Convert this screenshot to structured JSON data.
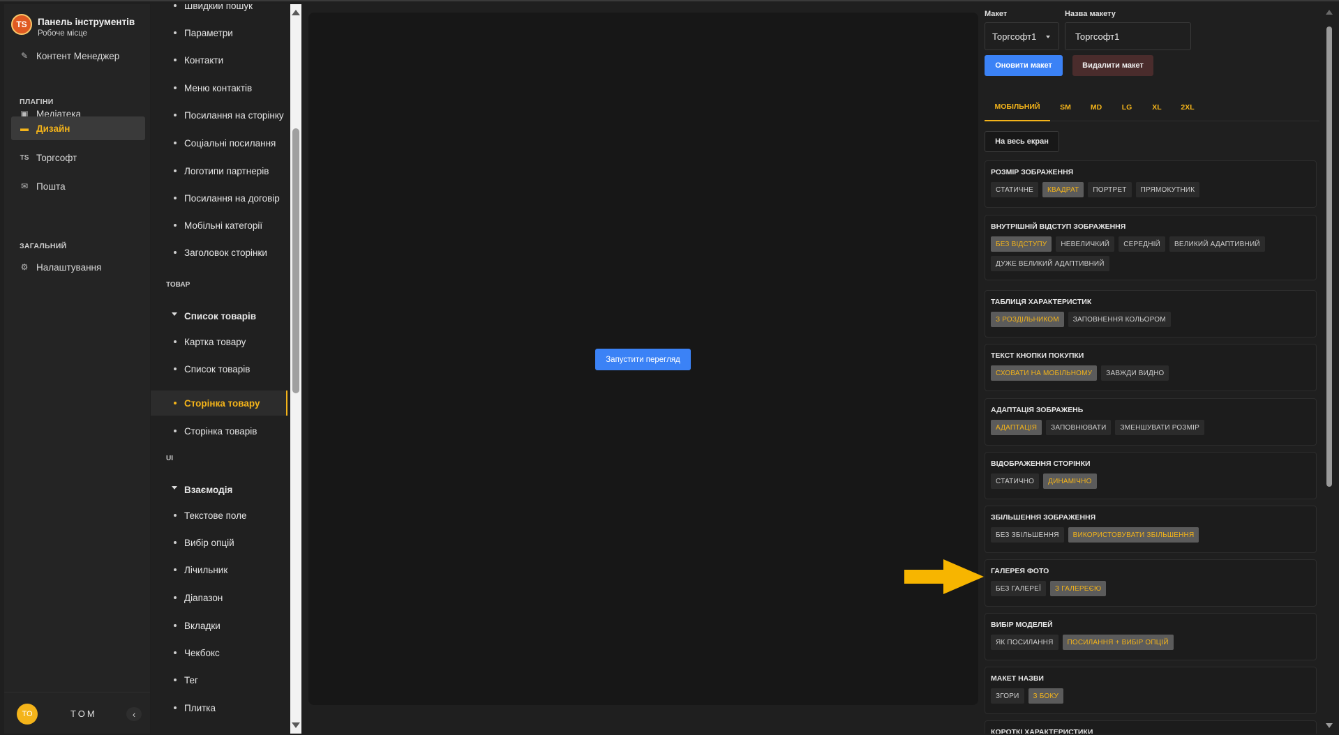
{
  "brand": {
    "logo": "TS",
    "title": "Панель інструментів",
    "subtitle": "Робоче місце"
  },
  "sidebar": {
    "items": [
      {
        "label": "Контент Менеджер",
        "icon": "edit-icon"
      },
      {
        "label": "Медіатека",
        "icon": "image-icon"
      },
      {
        "label": "Дизайн",
        "icon": "design-icon",
        "active": true
      },
      {
        "label": "Торгсофт",
        "icon": "ts-icon"
      },
      {
        "label": "Пошта",
        "icon": "mail-icon"
      },
      {
        "label": "Налаштування",
        "icon": "gear-icon"
      }
    ],
    "sections": {
      "plugins": "ПЛАГІНИ",
      "general": "ЗАГАЛЬНИЙ"
    },
    "user": {
      "initials": "TO",
      "name": "TOM"
    }
  },
  "tree": {
    "partial_top": "Швидкий пошук",
    "items": [
      "Параметри",
      "Контакти",
      "Меню контактів",
      "Посилання на сторінку",
      "Соціальні посилання",
      "Логотипи партнерів",
      "Посилання на договір",
      "Мобільні категорії",
      "Заголовок сторінки"
    ],
    "section_product": "ТОВАР",
    "group_product_list": "Список товарів",
    "product_items": [
      "Картка товару",
      "Список товарів"
    ],
    "active_item": "Сторінка товару",
    "after_active": "Сторінка товарів",
    "section_ui": "UI",
    "group_interaction": "Взаємодія",
    "ui_items": [
      "Текстове поле",
      "Вибір опцій",
      "Лічильник",
      "Діапазон",
      "Вкладки",
      "Чекбокс",
      "Тег",
      "Плитка"
    ]
  },
  "canvas": {
    "run_label": "Запустити перегляд"
  },
  "settings": {
    "layout_label": "Макет",
    "layout_value": "Торгсофт1",
    "layout_name_label": "Назва макету",
    "layout_name_value": "Торгсофт1",
    "update_label": "Оновити макет",
    "delete_label": "Видалити макет",
    "tabs": [
      "МОБІЛЬНИЙ",
      "SM",
      "MD",
      "LG",
      "XL",
      "2XL"
    ],
    "fullscreen_label": "На весь екран",
    "groups": [
      {
        "title": "РОЗМІР ЗОБРАЖЕННЯ",
        "options": [
          "СТАТИЧНЕ",
          "КВАДРАТ",
          "ПОРТРЕТ",
          "ПРЯМОКУТНИК"
        ],
        "selected": 1
      },
      {
        "title": "ВНУТРІШНІЙ ВІДСТУП ЗОБРАЖЕННЯ",
        "options": [
          "БЕЗ ВІДСТУПУ",
          "НЕВЕЛИЧКИЙ",
          "СЕРЕДНІЙ",
          "ВЕЛИКИЙ АДАПТИВНИЙ",
          "ДУЖЕ ВЕЛИКИЙ АДАПТИВНИЙ"
        ],
        "selected": 0
      },
      {
        "title": "ТАБЛИЦЯ ХАРАКТЕРИСТИК",
        "options": [
          "З РОЗДІЛЬНИКОМ",
          "ЗАПОВНЕННЯ КОЛЬОРОМ"
        ],
        "selected": 0
      },
      {
        "title": "ТЕКСТ КНОПКИ ПОКУПКИ",
        "options": [
          "СХОВАТИ НА МОБІЛЬНОМУ",
          "ЗАВЖДИ ВИДНО"
        ],
        "selected": 0
      },
      {
        "title": "АДАПТАЦІЯ ЗОБРАЖЕНЬ",
        "options": [
          "АДАПТАЦІЯ",
          "ЗАПОВНЮВАТИ",
          "ЗМЕНШУВАТИ РОЗМІР"
        ],
        "selected": 0
      },
      {
        "title": "ВІДОБРАЖЕННЯ СТОРІНКИ",
        "options": [
          "СТАТИЧНО",
          "ДИНАМІЧНО"
        ],
        "selected": 1
      },
      {
        "title": "ЗБІЛЬШЕННЯ ЗОБРАЖЕННЯ",
        "options": [
          "БЕЗ ЗБІЛЬШЕННЯ",
          "ВИКОРИСТОВУВАТИ ЗБІЛЬШЕННЯ"
        ],
        "selected": 1
      },
      {
        "title": "ГАЛЕРЕЯ ФОТО",
        "options": [
          "БЕЗ ГАЛЕРЕЇ",
          "З ГАЛЕРЕЄЮ"
        ],
        "selected": 1
      },
      {
        "title": "ВИБІР МОДЕЛЕЙ",
        "options": [
          "ЯК ПОСИЛАННЯ",
          "ПОСИЛАННЯ + ВИБІР ОПЦІЙ"
        ],
        "selected": 1
      },
      {
        "title": "МАКЕТ НАЗВИ",
        "options": [
          "ЗГОРИ",
          "З БОКУ"
        ],
        "selected": 1
      },
      {
        "title": "КОРОТКІ ХАРАКТЕРИСТИКИ",
        "options": [],
        "selected": -1
      }
    ]
  },
  "colors": {
    "accent": "#f4b41a",
    "primary": "#3b82f6",
    "danger": "#4a2c2c",
    "annotation_arrow": "#f7b500"
  }
}
